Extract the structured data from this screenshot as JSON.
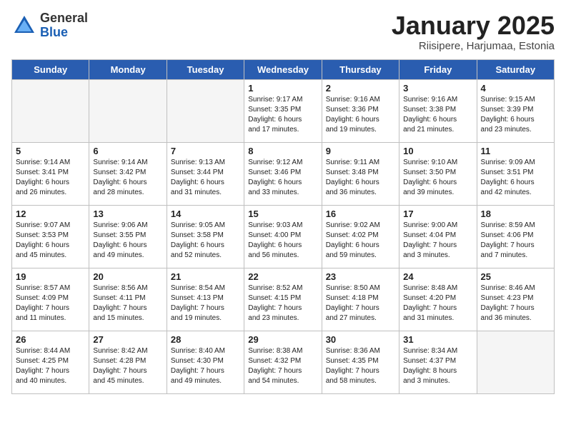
{
  "logo": {
    "general": "General",
    "blue": "Blue"
  },
  "title": "January 2025",
  "location": "Riisipere, Harjumaa, Estonia",
  "days_header": [
    "Sunday",
    "Monday",
    "Tuesday",
    "Wednesday",
    "Thursday",
    "Friday",
    "Saturday"
  ],
  "weeks": [
    [
      {
        "day": "",
        "info": ""
      },
      {
        "day": "",
        "info": ""
      },
      {
        "day": "",
        "info": ""
      },
      {
        "day": "1",
        "info": "Sunrise: 9:17 AM\nSunset: 3:35 PM\nDaylight: 6 hours\nand 17 minutes."
      },
      {
        "day": "2",
        "info": "Sunrise: 9:16 AM\nSunset: 3:36 PM\nDaylight: 6 hours\nand 19 minutes."
      },
      {
        "day": "3",
        "info": "Sunrise: 9:16 AM\nSunset: 3:38 PM\nDaylight: 6 hours\nand 21 minutes."
      },
      {
        "day": "4",
        "info": "Sunrise: 9:15 AM\nSunset: 3:39 PM\nDaylight: 6 hours\nand 23 minutes."
      }
    ],
    [
      {
        "day": "5",
        "info": "Sunrise: 9:14 AM\nSunset: 3:41 PM\nDaylight: 6 hours\nand 26 minutes."
      },
      {
        "day": "6",
        "info": "Sunrise: 9:14 AM\nSunset: 3:42 PM\nDaylight: 6 hours\nand 28 minutes."
      },
      {
        "day": "7",
        "info": "Sunrise: 9:13 AM\nSunset: 3:44 PM\nDaylight: 6 hours\nand 31 minutes."
      },
      {
        "day": "8",
        "info": "Sunrise: 9:12 AM\nSunset: 3:46 PM\nDaylight: 6 hours\nand 33 minutes."
      },
      {
        "day": "9",
        "info": "Sunrise: 9:11 AM\nSunset: 3:48 PM\nDaylight: 6 hours\nand 36 minutes."
      },
      {
        "day": "10",
        "info": "Sunrise: 9:10 AM\nSunset: 3:50 PM\nDaylight: 6 hours\nand 39 minutes."
      },
      {
        "day": "11",
        "info": "Sunrise: 9:09 AM\nSunset: 3:51 PM\nDaylight: 6 hours\nand 42 minutes."
      }
    ],
    [
      {
        "day": "12",
        "info": "Sunrise: 9:07 AM\nSunset: 3:53 PM\nDaylight: 6 hours\nand 45 minutes."
      },
      {
        "day": "13",
        "info": "Sunrise: 9:06 AM\nSunset: 3:55 PM\nDaylight: 6 hours\nand 49 minutes."
      },
      {
        "day": "14",
        "info": "Sunrise: 9:05 AM\nSunset: 3:58 PM\nDaylight: 6 hours\nand 52 minutes."
      },
      {
        "day": "15",
        "info": "Sunrise: 9:03 AM\nSunset: 4:00 PM\nDaylight: 6 hours\nand 56 minutes."
      },
      {
        "day": "16",
        "info": "Sunrise: 9:02 AM\nSunset: 4:02 PM\nDaylight: 6 hours\nand 59 minutes."
      },
      {
        "day": "17",
        "info": "Sunrise: 9:00 AM\nSunset: 4:04 PM\nDaylight: 7 hours\nand 3 minutes."
      },
      {
        "day": "18",
        "info": "Sunrise: 8:59 AM\nSunset: 4:06 PM\nDaylight: 7 hours\nand 7 minutes."
      }
    ],
    [
      {
        "day": "19",
        "info": "Sunrise: 8:57 AM\nSunset: 4:09 PM\nDaylight: 7 hours\nand 11 minutes."
      },
      {
        "day": "20",
        "info": "Sunrise: 8:56 AM\nSunset: 4:11 PM\nDaylight: 7 hours\nand 15 minutes."
      },
      {
        "day": "21",
        "info": "Sunrise: 8:54 AM\nSunset: 4:13 PM\nDaylight: 7 hours\nand 19 minutes."
      },
      {
        "day": "22",
        "info": "Sunrise: 8:52 AM\nSunset: 4:15 PM\nDaylight: 7 hours\nand 23 minutes."
      },
      {
        "day": "23",
        "info": "Sunrise: 8:50 AM\nSunset: 4:18 PM\nDaylight: 7 hours\nand 27 minutes."
      },
      {
        "day": "24",
        "info": "Sunrise: 8:48 AM\nSunset: 4:20 PM\nDaylight: 7 hours\nand 31 minutes."
      },
      {
        "day": "25",
        "info": "Sunrise: 8:46 AM\nSunset: 4:23 PM\nDaylight: 7 hours\nand 36 minutes."
      }
    ],
    [
      {
        "day": "26",
        "info": "Sunrise: 8:44 AM\nSunset: 4:25 PM\nDaylight: 7 hours\nand 40 minutes."
      },
      {
        "day": "27",
        "info": "Sunrise: 8:42 AM\nSunset: 4:28 PM\nDaylight: 7 hours\nand 45 minutes."
      },
      {
        "day": "28",
        "info": "Sunrise: 8:40 AM\nSunset: 4:30 PM\nDaylight: 7 hours\nand 49 minutes."
      },
      {
        "day": "29",
        "info": "Sunrise: 8:38 AM\nSunset: 4:32 PM\nDaylight: 7 hours\nand 54 minutes."
      },
      {
        "day": "30",
        "info": "Sunrise: 8:36 AM\nSunset: 4:35 PM\nDaylight: 7 hours\nand 58 minutes."
      },
      {
        "day": "31",
        "info": "Sunrise: 8:34 AM\nSunset: 4:37 PM\nDaylight: 8 hours\nand 3 minutes."
      },
      {
        "day": "",
        "info": ""
      }
    ]
  ]
}
